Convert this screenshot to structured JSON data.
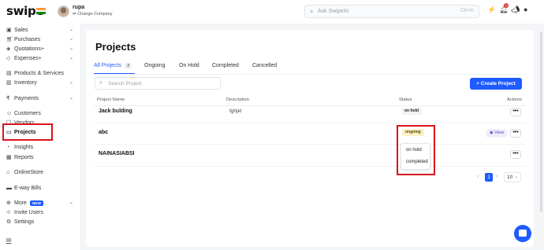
{
  "header": {
    "brand": "swipe",
    "company_name": "rupa",
    "change_company": "Change Company",
    "ai_search_placeholder": "Ask SwipeAI",
    "ai_search_shortcut": "Ctrl+K",
    "notification_count": "1"
  },
  "sidebar": {
    "items": [
      {
        "label": "Sales",
        "icon": "sales-icon",
        "chevron": "⌄"
      },
      {
        "label": "Purchases",
        "icon": "purchases-icon",
        "chevron": "⌄"
      },
      {
        "label": "Quotations+",
        "icon": "quotations-icon",
        "chevron": "⌄"
      },
      {
        "label": "Expenses+",
        "icon": "expenses-icon",
        "chevron": "⌄"
      },
      {
        "label": "Products & Services",
        "icon": "products-icon"
      },
      {
        "label": "Inventory",
        "icon": "inventory-icon",
        "chevron": "⌄"
      },
      {
        "label": "Payments",
        "icon": "payments-icon",
        "chevron": "⌄"
      },
      {
        "label": "Customers",
        "icon": "customers-icon"
      },
      {
        "label": "Vendors",
        "icon": "vendors-icon"
      },
      {
        "label": "Projects",
        "icon": "projects-icon"
      },
      {
        "label": "Insights",
        "icon": "insights-icon"
      },
      {
        "label": "Reports",
        "icon": "reports-icon"
      },
      {
        "label": "OnlineStore",
        "icon": "store-icon"
      },
      {
        "label": "E-way Bills",
        "icon": "truck-icon"
      },
      {
        "label": "More",
        "icon": "more-icon",
        "badge": "NEW",
        "chevron": "⌄"
      },
      {
        "label": "Invite Users",
        "icon": "invite-icon"
      },
      {
        "label": "Settings",
        "icon": "gear-icon"
      }
    ]
  },
  "main": {
    "title": "Projects",
    "tabs": [
      {
        "label": "All Projects",
        "count": "3"
      },
      {
        "label": "Ongoing"
      },
      {
        "label": "On Hold"
      },
      {
        "label": "Completed"
      },
      {
        "label": "Cancelled"
      }
    ],
    "search_placeholder": "Search Project",
    "create_button": "+ Create Project",
    "table": {
      "columns": [
        "Project Name",
        "Description",
        "Status",
        "Actions"
      ],
      "rows": [
        {
          "name": "Jack bulding",
          "description": "fghjkl",
          "status": "on hold"
        },
        {
          "name": "abc",
          "description": "",
          "status": "ongoing",
          "view": "View"
        },
        {
          "name": "NAINASIABSI",
          "description": "",
          "status": ""
        }
      ]
    },
    "status_menu": [
      "on hold",
      "completed"
    ],
    "pagination": {
      "prev": "‹",
      "current": "1",
      "next": "›",
      "page_size": "10"
    },
    "actions_label": "•••"
  },
  "colors": {
    "accent": "#1f5cff",
    "highlight": "#d9151a"
  }
}
